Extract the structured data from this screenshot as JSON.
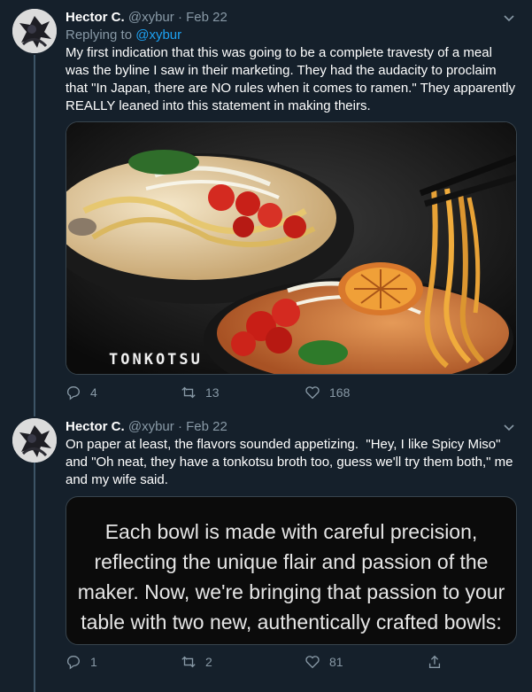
{
  "tweets": [
    {
      "name": "Hector C.",
      "handle": "@xybur",
      "dot": "·",
      "date": "Feb 22",
      "replying_prefix": "Replying to ",
      "replying_to": "@xybur",
      "text": "My first indication that this was going to be a complete travesty of a meal was the byline I saw in their marketing. They had the audacity to proclaim that \"In Japan, there are NO rules when it comes to ramen.\" They apparently REALLY leaned into this statement in making theirs.",
      "image_label": "TONKOTSU",
      "replies": "4",
      "retweets": "13",
      "likes": "168"
    },
    {
      "name": "Hector C.",
      "handle": "@xybur",
      "dot": "·",
      "date": "Feb 22",
      "text": "On paper at least, the flavors sounded appetizing.  \"Hey, I like Spicy Miso\" and \"Oh neat, they have a tonkotsu broth too, guess we'll try them both,\" me and my wife said.",
      "image_text": "Each bowl is made with careful precision, reflecting the unique flair and passion of the maker. Now, we're bringing that passion to your table with two new, authentically crafted bowls: Spicy Miso, and Tonkotsu.",
      "replies": "1",
      "retweets": "2",
      "likes": "81"
    }
  ],
  "icons": {
    "reply": "reply-icon",
    "retweet": "retweet-icon",
    "like": "heart-icon",
    "share": "share-icon",
    "caret": "chevron-down-icon"
  },
  "colors": {
    "background": "#15202b",
    "secondary_text": "#8899a6",
    "link": "#1da1f2",
    "thread_line": "#3d5466"
  }
}
